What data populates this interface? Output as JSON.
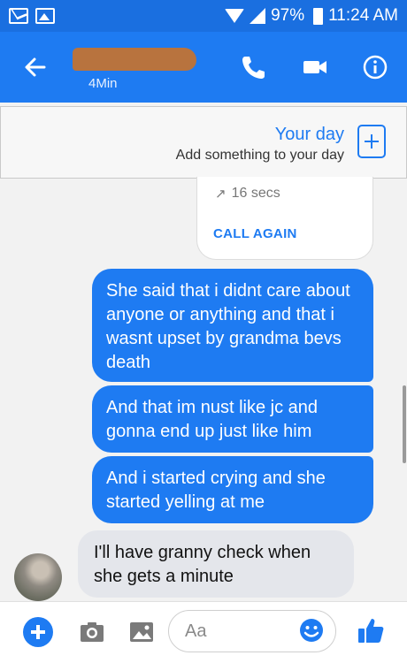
{
  "status_bar": {
    "left_icons": [
      "mail-icon",
      "image-icon"
    ],
    "battery": "97%",
    "time": "11:24 AM"
  },
  "header": {
    "subtitle": "4Min",
    "icons": [
      "back-arrow-icon",
      "phone-icon",
      "video-camera-icon",
      "info-icon"
    ],
    "accent_color": "#1e7bf2"
  },
  "your_day": {
    "title": "Your day",
    "subtitle": "Add something to your day"
  },
  "call_card": {
    "duration": "16 secs",
    "action": "CALL AGAIN"
  },
  "messages": [
    {
      "direction": "outgoing",
      "text": "She said that i didnt care about anyone or anything and that i wasnt upset by grandma bevs death"
    },
    {
      "direction": "outgoing",
      "text": "And that im nust like jc and gonna end up just like him"
    },
    {
      "direction": "outgoing",
      "text": "And i started crying and she started yelling at me"
    },
    {
      "direction": "incoming",
      "text": "I'll have granny check when she gets a minute"
    }
  ],
  "composer": {
    "placeholder": "Aa",
    "icons": [
      "plus-icon",
      "camera-icon",
      "gallery-icon",
      "emoji-icon",
      "thumbs-up-icon"
    ]
  }
}
